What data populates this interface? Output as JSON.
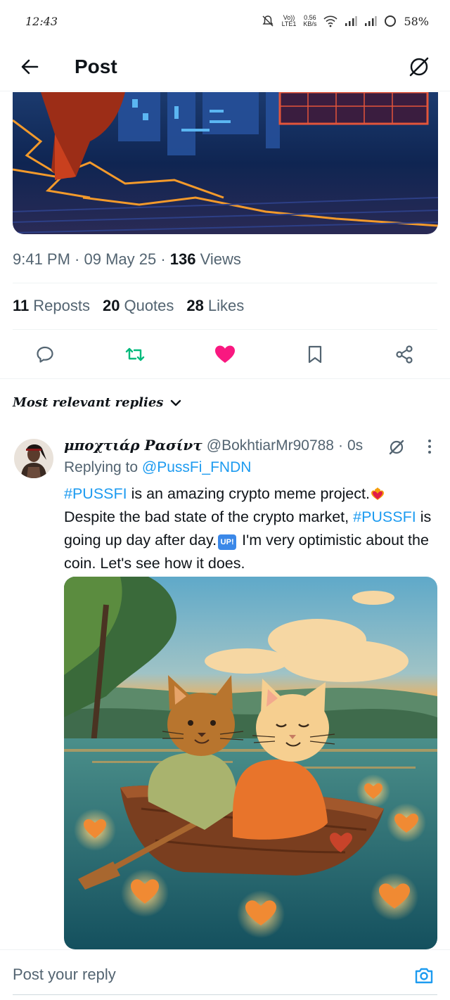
{
  "status_bar": {
    "time": "12:43",
    "volte": "Vo))",
    "lte": "LTE1",
    "speed_value": "0.56",
    "speed_unit": "KB/s",
    "battery": "58%",
    "icons": [
      "mute-bell-icon",
      "wifi-icon",
      "signal-icon",
      "signal-icon",
      "battery-ring-icon"
    ]
  },
  "header": {
    "title": "Post",
    "back_icon": "arrow-left-icon",
    "grok_icon": "grok-icon"
  },
  "post": {
    "time": "9:41 PM",
    "date": "09 May 25",
    "views_count": "136",
    "views_label": "Views",
    "reposts_count": "11",
    "reposts_label": "Reposts",
    "quotes_count": "20",
    "quotes_label": "Quotes",
    "likes_count": "28",
    "likes_label": "Likes",
    "liked": true,
    "colors": {
      "repost": "#00ba7c",
      "like": "#f91880",
      "link": "#1d9bf0"
    }
  },
  "sort": {
    "label": "Most relevant replies"
  },
  "reply": {
    "name": "μποχτιάρ Ρασίντ",
    "handle": "@BokhtiarMr90788",
    "time": "0s",
    "replying_prefix": "Replying to",
    "replying_to": "@PussFi_FNDN",
    "body": {
      "tag1": "#PUSSFI",
      "text1": " is an amazing crypto meme project.",
      "text2": " Despite the bad state of the crypto market, ",
      "tag2": "#PUSSFI",
      "text3": " is going up day after day.",
      "up_badge": "UP!",
      "text4": " I'm very optimistic about the coin. Let's see how it does."
    }
  },
  "reply_bar": {
    "placeholder": "Post your reply",
    "camera_icon": "camera-icon"
  }
}
